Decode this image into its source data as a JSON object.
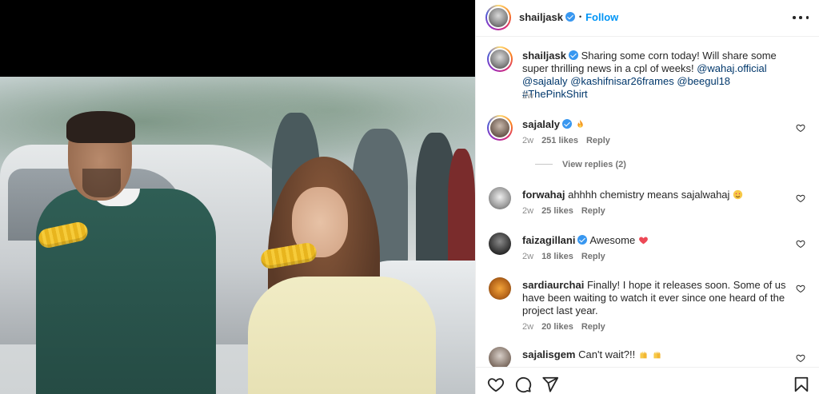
{
  "post": {
    "author": "shailjask",
    "follow_label": "Follow",
    "dot": "•"
  },
  "caption": {
    "username": "shailjask",
    "text_before": "Sharing some corn today! Will share some super thrilling news in a cpl of weeks! ",
    "mentions": [
      "@wahaj.official",
      "@sajalaly",
      "@kashifnisar26frames",
      "@beegul18",
      "#ThePinkShirt"
    ],
    "time": "2w"
  },
  "comments": [
    {
      "username": "sajalaly",
      "verified": true,
      "text": "",
      "emoji": "fire-emoji",
      "time": "2w",
      "likes": "251 likes",
      "reply": "Reply",
      "view_replies": "View replies (2)"
    },
    {
      "username": "forwahaj",
      "verified": false,
      "text": "ahhhh chemistry means sajalwahaj",
      "emoji": "heart-eyes-emoji",
      "time": "2w",
      "likes": "25 likes",
      "reply": "Reply"
    },
    {
      "username": "faizagillani",
      "verified": true,
      "text": "Awesome",
      "emoji": "red-heart-emoji",
      "time": "2w",
      "likes": "18 likes",
      "reply": "Reply"
    },
    {
      "username": "sardiaurchai",
      "verified": false,
      "text": "Finally! I hope it releases soon. Some of us have been waiting to watch it ever since one heard of the project last year.",
      "time": "2w",
      "likes": "20 likes",
      "reply": "Reply"
    },
    {
      "username": "sajalisgem",
      "verified": false,
      "text": "Can't wait?!!",
      "emoji": "raising-hands-emoji",
      "time": "",
      "likes": "",
      "reply": ""
    }
  ],
  "colors": {
    "link": "#00376b",
    "follow": "#0095f6",
    "verified": "#3897f0",
    "heart_red": "#ed4956"
  },
  "icons": [
    "verified-badge-icon",
    "more-options-icon",
    "heart-icon",
    "comment-icon",
    "share-icon",
    "bookmark-icon"
  ]
}
